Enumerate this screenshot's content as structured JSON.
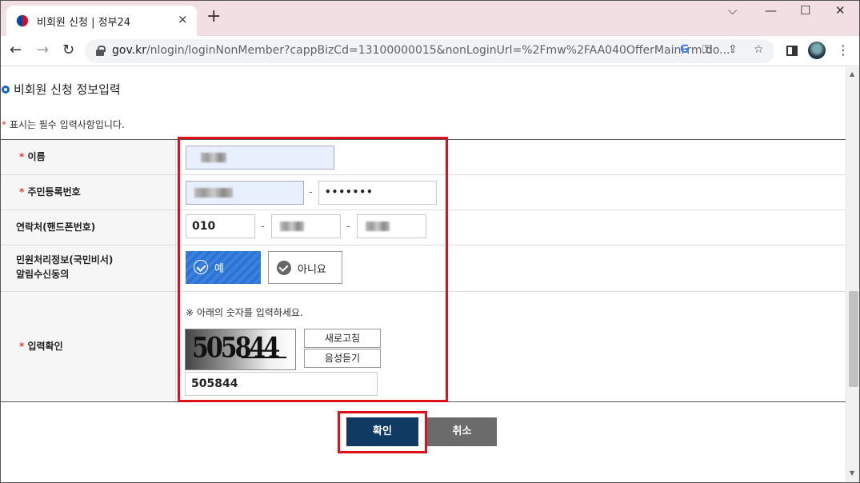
{
  "browser": {
    "tab_title": "비회원 신청 | 정부24",
    "tab_close": "×",
    "new_tab": "+",
    "window_controls": {
      "dropdown": "⌵",
      "minimize": "—",
      "maximize": "☐",
      "close": "✕"
    },
    "nav": {
      "back": "←",
      "forward": "→",
      "reload": "↻"
    },
    "url_host": "gov.kr",
    "url_path": "/nlogin/loginNonMember?cappBizCd=13100000015&nonLoginUrl=%2Fmw%2FAA040OfferMainFrm.do...",
    "omnibox_icons": {
      "google": "G",
      "key": "⚿",
      "share": "⇪",
      "bookmark": "☆"
    },
    "menu": "⋮"
  },
  "page": {
    "section_title": "비회원 신청 정보입력",
    "required_marker": "*",
    "required_note": "표시는 필수 입력사항입니다."
  },
  "form": {
    "name_label": "이름",
    "rrn_label": "주민등록번호",
    "rrn_back_value": "•••••••",
    "phone_label": "연락처(핸드폰번호)",
    "phone_first_value": "010",
    "dash": "-",
    "consent_label_line1": "민원처리정보(국민비서)",
    "consent_label_line2": "알림수신동의",
    "consent_yes": "예",
    "consent_no": "아니요",
    "captcha_label": "입력확인",
    "captcha_note": "※ 아래의 숫자를 입력하세요.",
    "captcha_image_text": "505844",
    "refresh_button": "새로고침",
    "audio_button": "음성듣기",
    "captcha_input_value": "505844"
  },
  "actions": {
    "confirm": "확인",
    "cancel": "취소"
  },
  "colors": {
    "highlight": "#e0101a",
    "confirm_bg": "#113a63",
    "cancel_bg": "#6b6b6b",
    "yes_bg": "#3b82e0",
    "tabbar_bg": "#f1dfe3"
  }
}
